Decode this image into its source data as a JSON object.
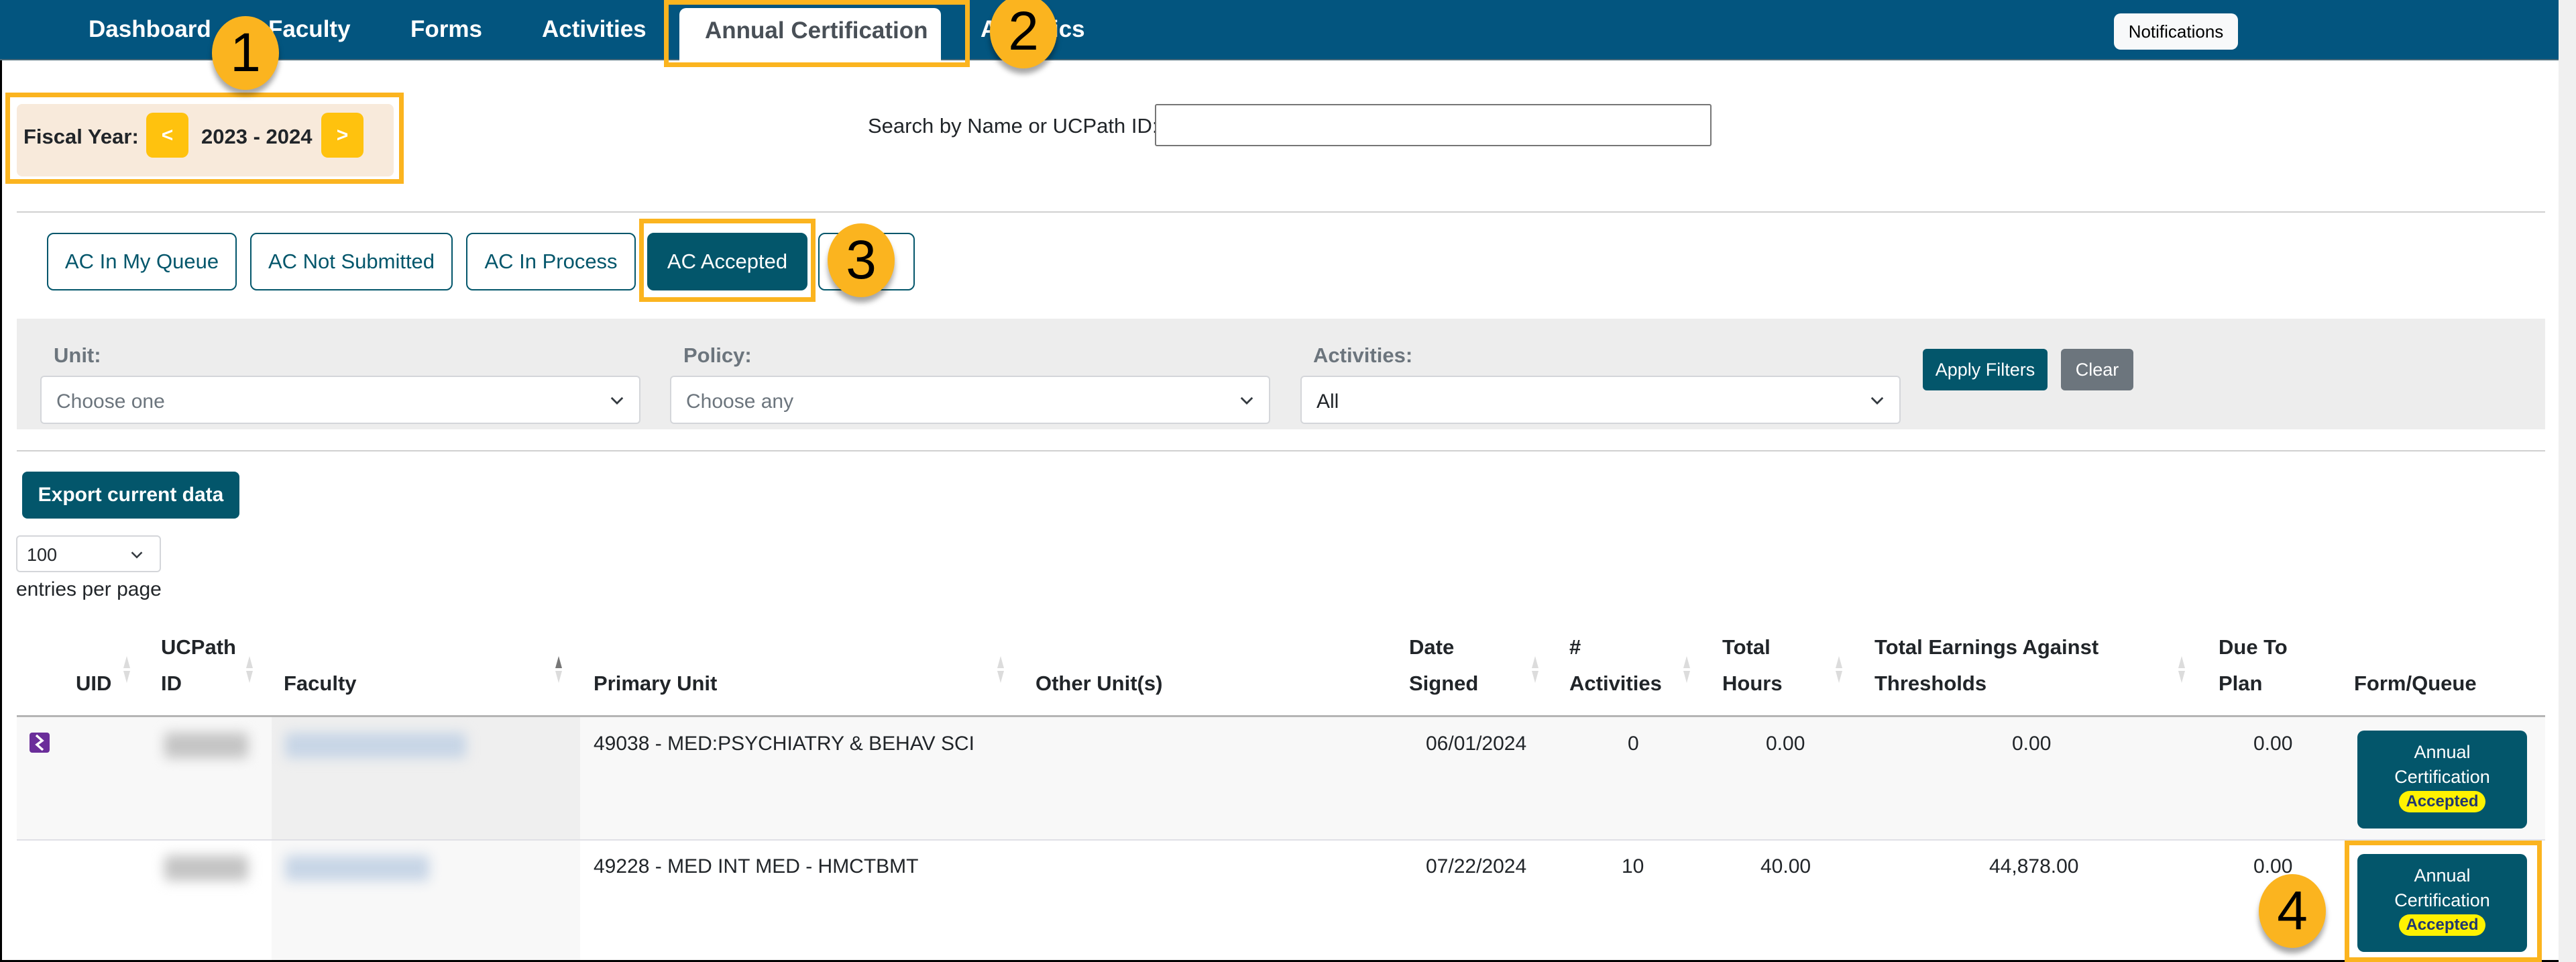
{
  "nav": {
    "items": [
      {
        "label": "Dashboard"
      },
      {
        "label": "Faculty"
      },
      {
        "label": "Forms"
      },
      {
        "label": "Activities"
      },
      {
        "label": "Annual Certification",
        "active": true
      },
      {
        "label": "Analytics"
      }
    ],
    "notifications_label": "Notifications"
  },
  "fiscal_year": {
    "label": "Fiscal Year:",
    "prev_label": "<",
    "value": "2023 - 2024",
    "next_label": ">"
  },
  "search": {
    "label": "Search by Name or UCPath ID:",
    "value": "",
    "placeholder": ""
  },
  "status_tabs": [
    {
      "label": "AC In My Queue"
    },
    {
      "label": "AC Not Submitted"
    },
    {
      "label": "AC In Process"
    },
    {
      "label": "AC Accepted",
      "active": true
    },
    {
      "label": ""
    }
  ],
  "filters": {
    "unit": {
      "label": "Unit:",
      "value": "Choose one"
    },
    "policy": {
      "label": "Policy:",
      "value": "Choose any"
    },
    "activities": {
      "label": "Activities:",
      "value": "All"
    },
    "apply_label": "Apply Filters",
    "clear_label": "Clear"
  },
  "export_label": "Export current data",
  "per_page": {
    "value": "100",
    "label": "entries per page"
  },
  "table": {
    "columns": [
      {
        "line1": "",
        "line2": "UID"
      },
      {
        "line1": "UCPath",
        "line2": "ID"
      },
      {
        "line1": "",
        "line2": "Faculty",
        "sort": "asc"
      },
      {
        "line1": "",
        "line2": "Primary Unit"
      },
      {
        "line1": "",
        "line2": "Other Unit(s)"
      },
      {
        "line1": "Date",
        "line2": "Signed"
      },
      {
        "line1": "#",
        "line2": "Activities"
      },
      {
        "line1": "Total",
        "line2": "Hours"
      },
      {
        "line1": "Total Earnings Against",
        "line2": "Thresholds"
      },
      {
        "line1": "Due To",
        "line2": "Plan"
      },
      {
        "line1": "",
        "line2": "Form/Queue"
      }
    ],
    "rows": [
      {
        "uid_icon": "extension-logo-icon",
        "ucpath_id": "[redacted]",
        "faculty": "[redacted]",
        "primary_unit": "49038 - MED:PSYCHIATRY & BEHAV SCI",
        "other_units": "",
        "date_signed": "06/01/2024",
        "activities": "0",
        "total_hours": "0.00",
        "total_earnings": "0.00",
        "due_to_plan": "0.00",
        "form_line1": "Annual",
        "form_line2": "Certification",
        "status": "Accepted"
      },
      {
        "uid_icon": "",
        "ucpath_id": "[redacted]",
        "faculty": "[redacted]",
        "primary_unit": "49228 - MED INT MED - HMCTBMT",
        "other_units": "",
        "date_signed": "07/22/2024",
        "activities": "10",
        "total_hours": "40.00",
        "total_earnings": "44,878.00",
        "due_to_plan": "0.00",
        "form_line1": "Annual",
        "form_line2": "Certification",
        "status": "Accepted"
      }
    ]
  },
  "callouts": [
    "1",
    "2",
    "3",
    "4"
  ],
  "colors": {
    "navbar": "#03557f",
    "primary_teal": "#03566b",
    "fiscal_button": "#ffc20e",
    "fiscal_panel": "#f8eadb",
    "callout": "#fbb41f",
    "accepted_badge": "#fff200",
    "clear_button": "#6c757d"
  }
}
